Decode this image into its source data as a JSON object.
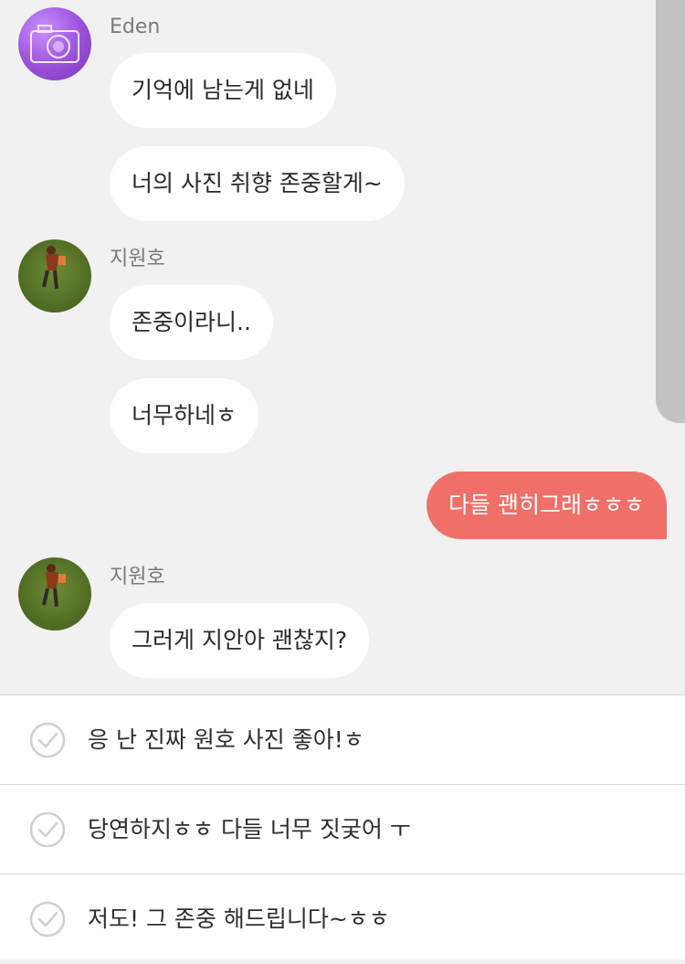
{
  "messages": [
    {
      "sender": "Eden",
      "avatar": "camera-avatar",
      "texts": [
        "기억에 남는게 없네",
        "너의 사진 취향 존중할게~"
      ]
    },
    {
      "sender": "지원호",
      "avatar": "grass-photo-avatar",
      "texts": [
        "존중이라니..",
        "너무하네ㅎ"
      ]
    },
    {
      "outgoing": "다들 괜히그래ㅎㅎㅎ"
    },
    {
      "sender": "지원호",
      "avatar": "grass-photo-avatar",
      "texts": [
        "그러게 지안아 괜찮지?"
      ]
    }
  ],
  "reply_options": [
    "응 난 진짜 원호 사진 좋아!ㅎ",
    "당연하지ㅎㅎ 다들 너무 짓궂어 ㅜ",
    "저도! 그 존중 해드립니다~ㅎㅎ"
  ],
  "colors": {
    "background": "#f1f1f1",
    "incoming_bubble": "#ffffff",
    "outgoing_bubble": "#ef7069",
    "scrollbar": "#c2c2c2"
  }
}
